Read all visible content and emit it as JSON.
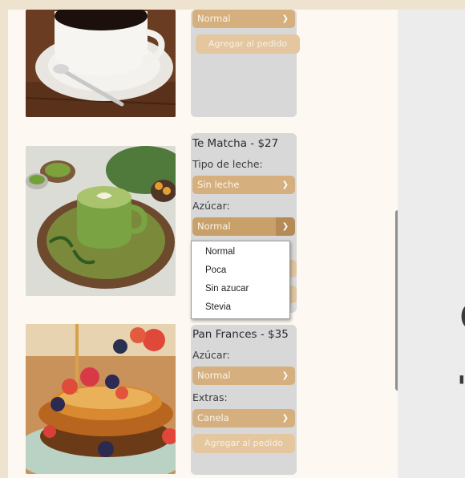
{
  "coffee_item": {
    "sugar_select": "Normal",
    "add_button": "Agregar al pedido"
  },
  "matcha_item": {
    "title": "Te Matcha - $27",
    "milk_label": "Tipo de leche:",
    "milk_select": "Sin leche",
    "sugar_label": "Azúcar:",
    "sugar_select": "Normal",
    "sugar_options": [
      "Normal",
      "Poca",
      "Sin azucar",
      "Stevia"
    ]
  },
  "french_toast_item": {
    "title": "Pan Frances - $35",
    "sugar_label": "Azúcar:",
    "sugar_select": "Normal",
    "extras_label": "Extras:",
    "extras_select": "Canela",
    "add_button": "Agregar al pedido"
  }
}
